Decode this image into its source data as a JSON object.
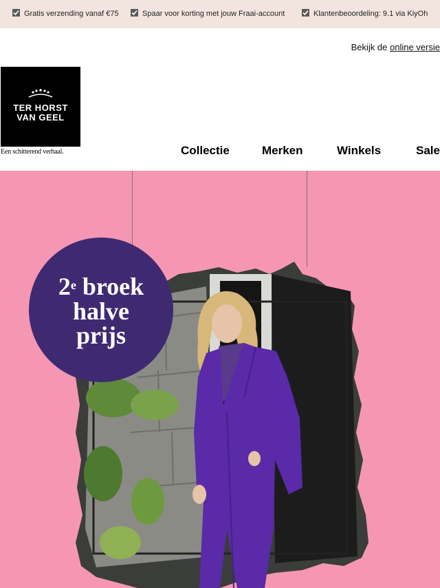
{
  "usp_bar": {
    "items": [
      {
        "icon": "checkmark-icon",
        "label": "Gratis verzending vanaf €75"
      },
      {
        "icon": "checkmark-icon",
        "label": "Spaar voor korting met jouw Fraai-account"
      },
      {
        "icon": "checkmark-icon",
        "label": "Klantenbeoordeling: 9.1 via KiyOh"
      }
    ]
  },
  "online_version": {
    "prefix": "Bekijk de",
    "link_label": "online versie"
  },
  "logo": {
    "line1": "TER HORST",
    "line2": "VAN GEEL",
    "tagline": "Een schitterend verhaal."
  },
  "nav": {
    "items": [
      "Collectie",
      "Merken",
      "Winkels",
      "Sale"
    ]
  },
  "hero": {
    "badge": {
      "number": "2",
      "superscript": "e",
      "word1": "broek",
      "line2": "halve",
      "line3": "prijs"
    }
  },
  "colors": {
    "usp_background": "#f2e4df",
    "hero_background": "#f597b3",
    "badge_background": "#3f2a72",
    "suit_purple": "#5a2aa8"
  }
}
